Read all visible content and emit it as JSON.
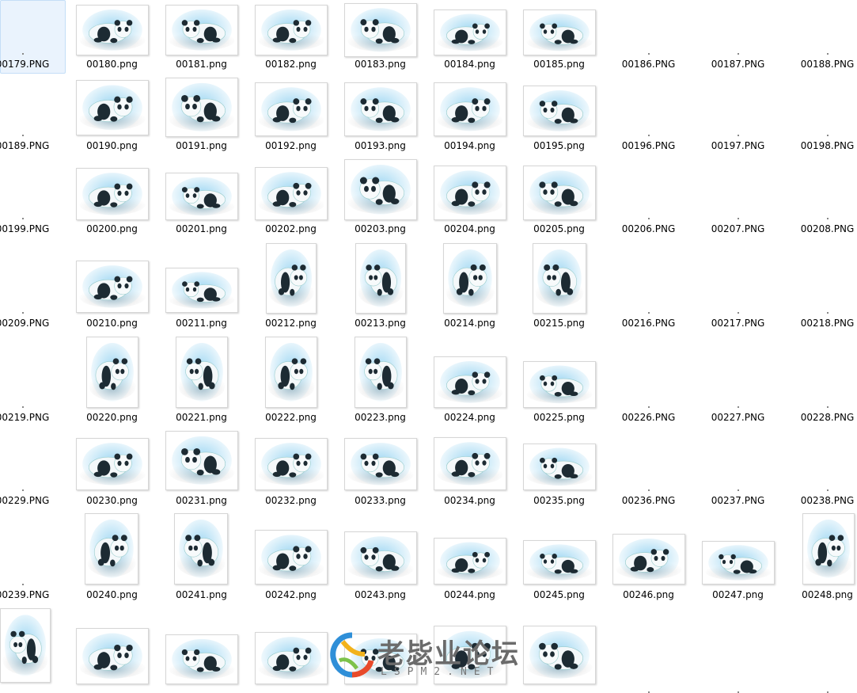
{
  "files": [
    {
      "name": "00179.PNG",
      "thumb": false,
      "selected": true
    },
    {
      "name": "00180.png",
      "thumb": true
    },
    {
      "name": "00181.png",
      "thumb": true
    },
    {
      "name": "00182.png",
      "thumb": true
    },
    {
      "name": "00183.png",
      "thumb": true
    },
    {
      "name": "00184.png",
      "thumb": true
    },
    {
      "name": "00185.png",
      "thumb": true
    },
    {
      "name": "00186.PNG",
      "thumb": false
    },
    {
      "name": "00187.PNG",
      "thumb": false
    },
    {
      "name": "00188.PNG",
      "thumb": false
    },
    {
      "name": "00189.PNG",
      "thumb": false
    },
    {
      "name": "00190.png",
      "thumb": true
    },
    {
      "name": "00191.png",
      "thumb": true
    },
    {
      "name": "00192.png",
      "thumb": true
    },
    {
      "name": "00193.png",
      "thumb": true
    },
    {
      "name": "00194.png",
      "thumb": true
    },
    {
      "name": "00195.png",
      "thumb": true
    },
    {
      "name": "00196.PNG",
      "thumb": false
    },
    {
      "name": "00197.PNG",
      "thumb": false
    },
    {
      "name": "00198.PNG",
      "thumb": false
    },
    {
      "name": "00199.PNG",
      "thumb": false
    },
    {
      "name": "00200.png",
      "thumb": true
    },
    {
      "name": "00201.png",
      "thumb": true
    },
    {
      "name": "00202.png",
      "thumb": true
    },
    {
      "name": "00203.png",
      "thumb": true
    },
    {
      "name": "00204.png",
      "thumb": true
    },
    {
      "name": "00205.png",
      "thumb": true
    },
    {
      "name": "00206.PNG",
      "thumb": false
    },
    {
      "name": "00207.PNG",
      "thumb": false
    },
    {
      "name": "00208.PNG",
      "thumb": false
    },
    {
      "name": "00209.PNG",
      "thumb": false
    },
    {
      "name": "00210.png",
      "thumb": true
    },
    {
      "name": "00211.png",
      "thumb": true
    },
    {
      "name": "00212.png",
      "thumb": true
    },
    {
      "name": "00213.png",
      "thumb": true
    },
    {
      "name": "00214.png",
      "thumb": true
    },
    {
      "name": "00215.png",
      "thumb": true
    },
    {
      "name": "00216.PNG",
      "thumb": false
    },
    {
      "name": "00217.PNG",
      "thumb": false
    },
    {
      "name": "00218.PNG",
      "thumb": false
    },
    {
      "name": "00219.PNG",
      "thumb": false
    },
    {
      "name": "00220.png",
      "thumb": true
    },
    {
      "name": "00221.png",
      "thumb": true
    },
    {
      "name": "00222.png",
      "thumb": true
    },
    {
      "name": "00223.png",
      "thumb": true
    },
    {
      "name": "00224.png",
      "thumb": true
    },
    {
      "name": "00225.png",
      "thumb": true
    },
    {
      "name": "00226.PNG",
      "thumb": false
    },
    {
      "name": "00227.PNG",
      "thumb": false
    },
    {
      "name": "00228.PNG",
      "thumb": false
    },
    {
      "name": "00229.PNG",
      "thumb": false
    },
    {
      "name": "00230.png",
      "thumb": true
    },
    {
      "name": "00231.png",
      "thumb": true
    },
    {
      "name": "00232.png",
      "thumb": true
    },
    {
      "name": "00233.png",
      "thumb": true
    },
    {
      "name": "00234.png",
      "thumb": true
    },
    {
      "name": "00235.png",
      "thumb": true
    },
    {
      "name": "00236.PNG",
      "thumb": false
    },
    {
      "name": "00237.PNG",
      "thumb": false
    },
    {
      "name": "00238.PNG",
      "thumb": false
    },
    {
      "name": "00239.PNG",
      "thumb": false
    },
    {
      "name": "00240.png",
      "thumb": true
    },
    {
      "name": "00241.png",
      "thumb": true
    },
    {
      "name": "00242.png",
      "thumb": true
    },
    {
      "name": "00243.png",
      "thumb": true
    },
    {
      "name": "00244.png",
      "thumb": true
    },
    {
      "name": "00245.png",
      "thumb": true
    },
    {
      "name": "00246.png",
      "thumb": true
    },
    {
      "name": "00247.png",
      "thumb": true
    },
    {
      "name": "00248.png",
      "thumb": true
    },
    {
      "name": "",
      "thumb": true
    },
    {
      "name": "",
      "thumb": true
    },
    {
      "name": "",
      "thumb": true
    },
    {
      "name": "",
      "thumb": true
    },
    {
      "name": "",
      "thumb": true
    },
    {
      "name": "",
      "thumb": true
    },
    {
      "name": "",
      "thumb": true
    },
    {
      "name": "",
      "thumb": false
    },
    {
      "name": "",
      "thumb": false
    },
    {
      "name": "",
      "thumb": false
    }
  ],
  "watermark": {
    "title": "老毖业论坛",
    "url": "LSPM2.NET"
  },
  "colors": {
    "selection": "#eaf3fd",
    "panda_glow": "#4fb6e8",
    "frame_border": "#d6d6d6"
  }
}
